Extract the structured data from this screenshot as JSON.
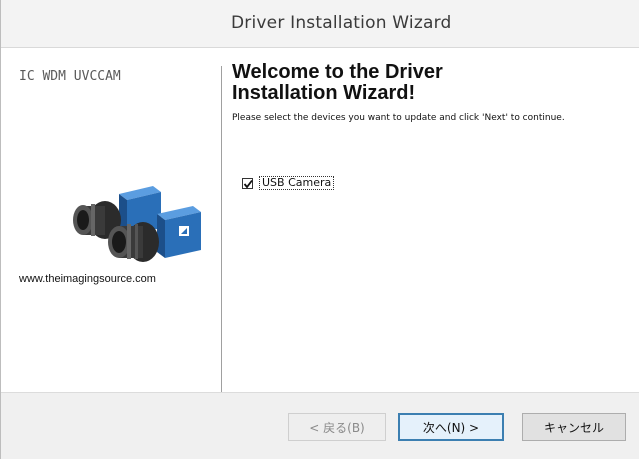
{
  "window": {
    "title": "Driver Installation Wizard"
  },
  "left_panel": {
    "product_name": "IC WDM UVCCAM",
    "website": "www.theimagingsource.com",
    "image_icon": "camera-icon"
  },
  "right_panel": {
    "heading": "Welcome to the Driver Installation Wizard!",
    "instructions": "Please select the devices you want to update and click 'Next' to continue.",
    "devices": [
      {
        "label": "USB Camera",
        "checked": true
      }
    ]
  },
  "footer": {
    "back_label": "< 戻る(B)",
    "next_label": "次へ(N) >",
    "cancel_label": "キャンセル"
  },
  "colors": {
    "camera_blue": "#2a6fb8",
    "default_button_border": "#3c7fb1"
  }
}
